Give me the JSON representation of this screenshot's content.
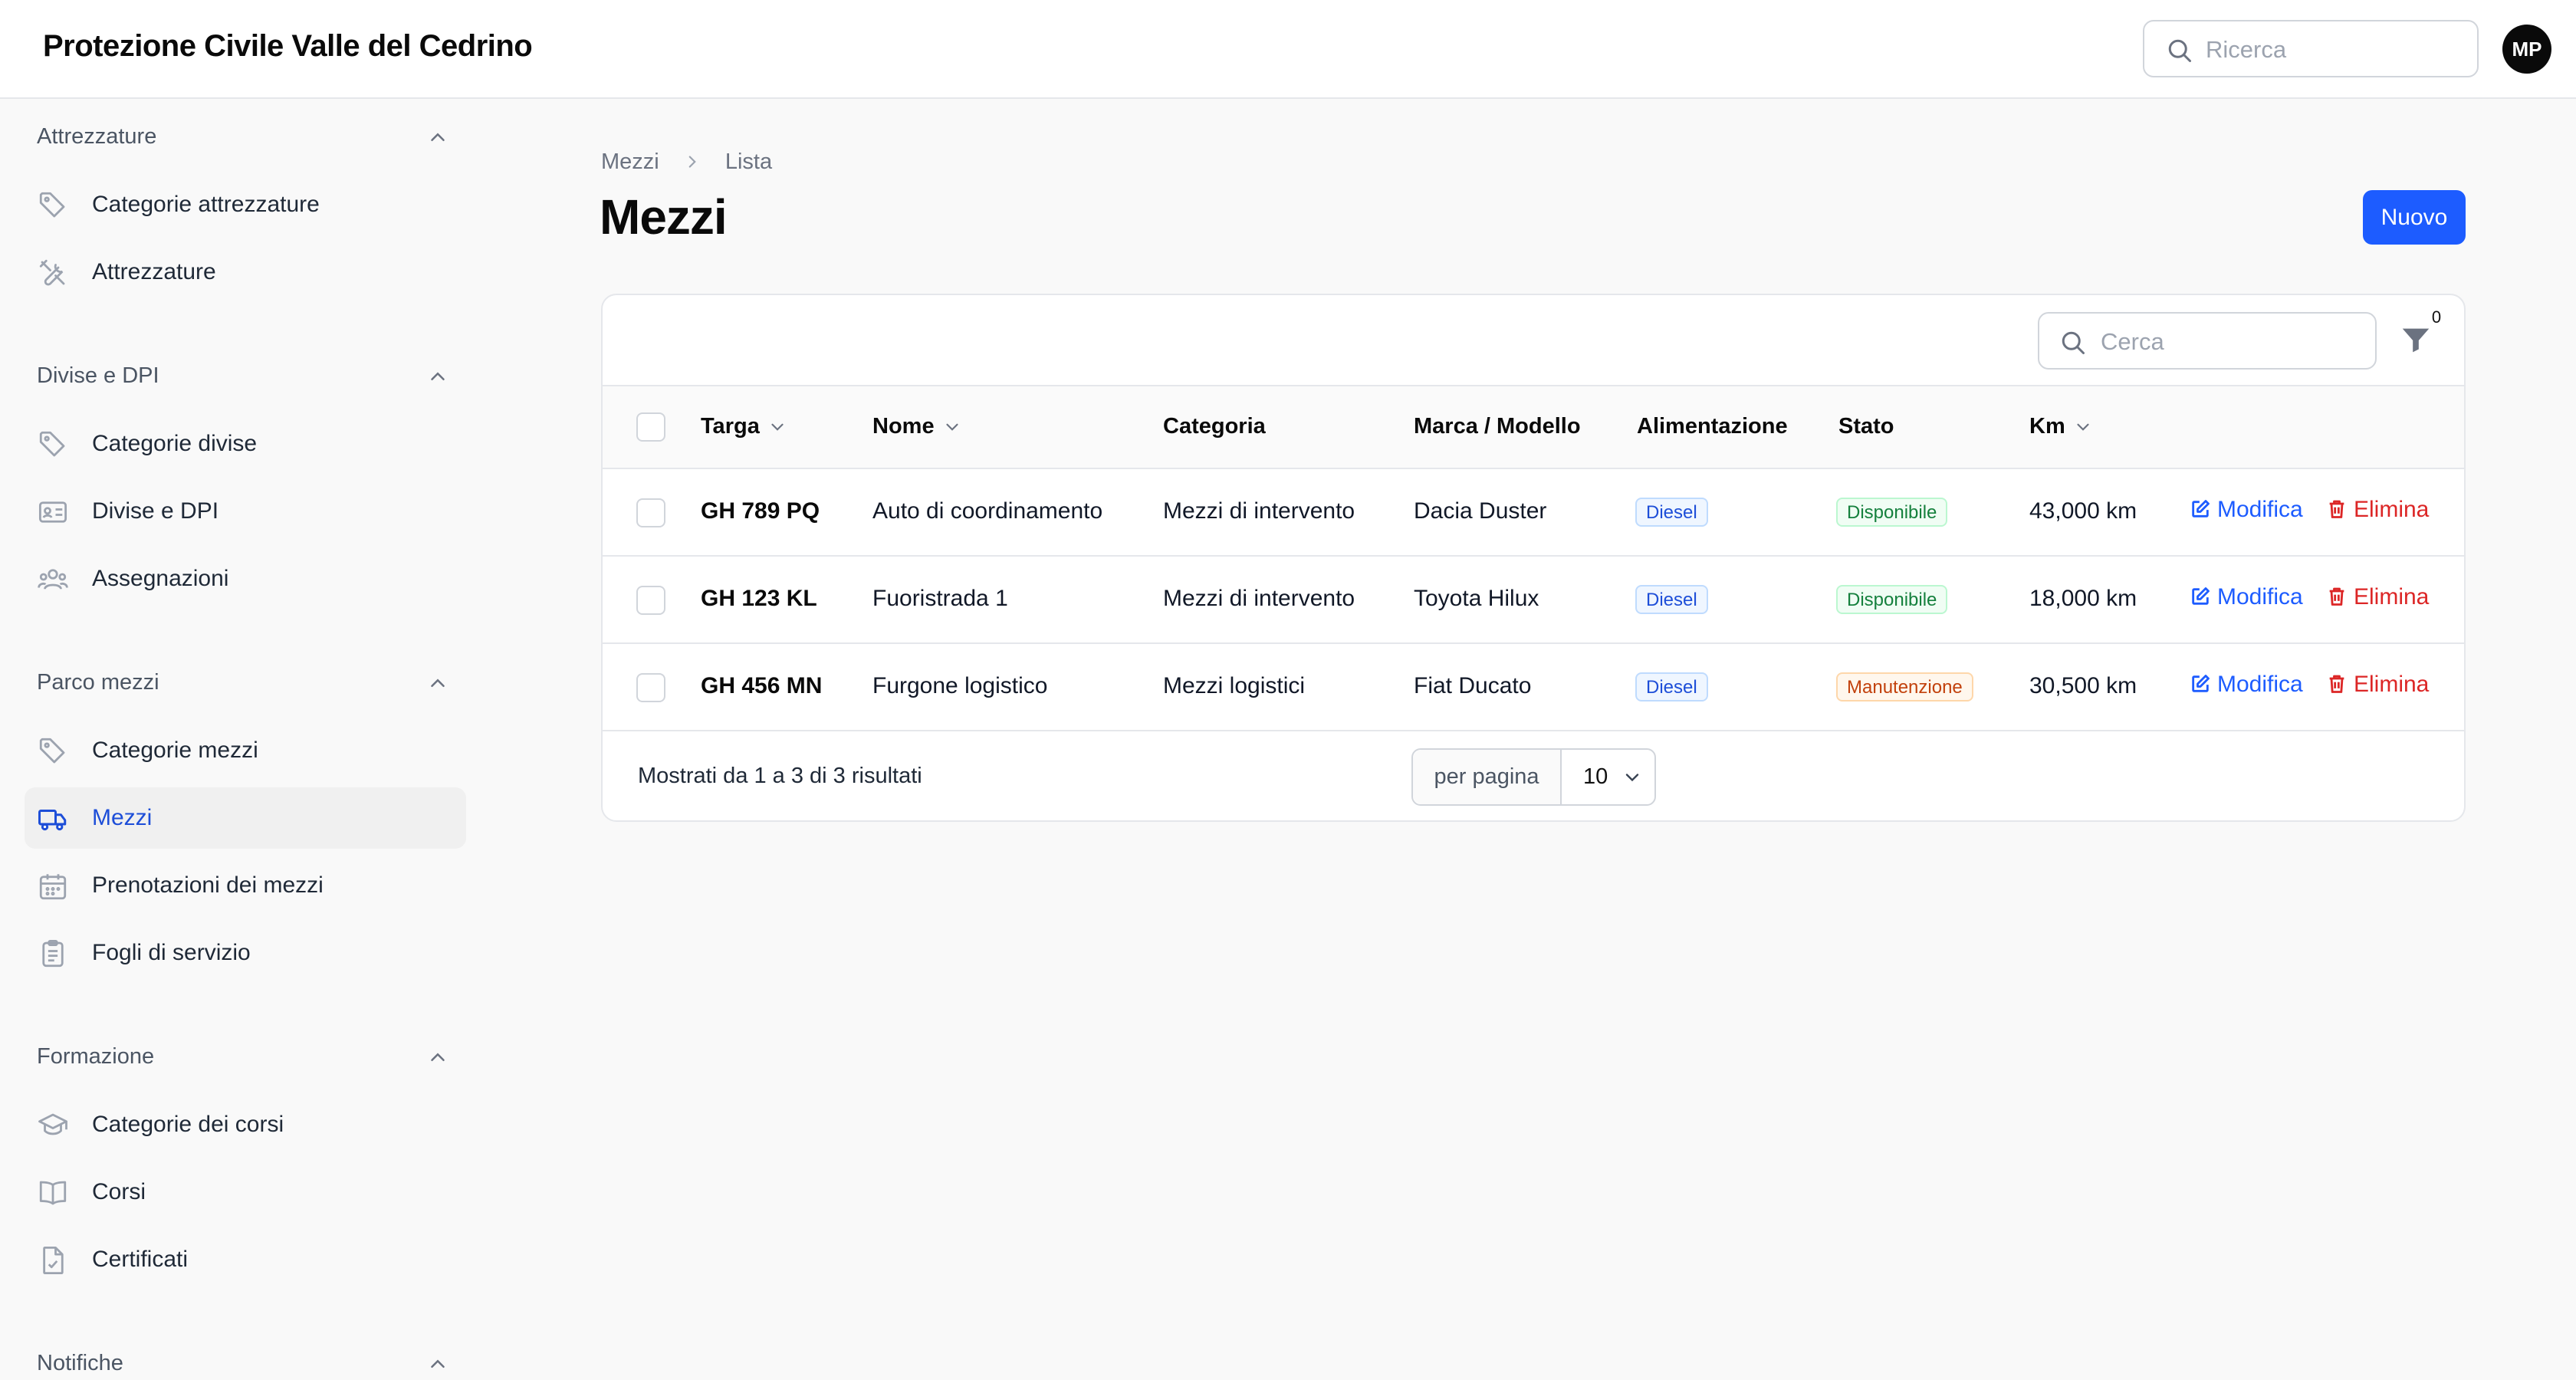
{
  "app": {
    "title": "Protezione Civile Valle del Cedrino",
    "search_placeholder": "Ricerca",
    "user_initials": "MP"
  },
  "sidebar": {
    "groups": [
      {
        "label": "Attrezzature",
        "items": [
          {
            "label": "Categorie attrezzature",
            "icon": "tag-icon"
          },
          {
            "label": "Attrezzature",
            "icon": "tools-icon"
          }
        ]
      },
      {
        "label": "Divise e DPI",
        "items": [
          {
            "label": "Categorie divise",
            "icon": "tag-icon"
          },
          {
            "label": "Divise e DPI",
            "icon": "id-card-icon"
          },
          {
            "label": "Assegnazioni",
            "icon": "users-icon"
          }
        ]
      },
      {
        "label": "Parco mezzi",
        "items": [
          {
            "label": "Categorie mezzi",
            "icon": "tag-icon"
          },
          {
            "label": "Mezzi",
            "icon": "truck-icon",
            "active": true
          },
          {
            "label": "Prenotazioni dei mezzi",
            "icon": "calendar-icon"
          },
          {
            "label": "Fogli di servizio",
            "icon": "clipboard-icon"
          }
        ]
      },
      {
        "label": "Formazione",
        "items": [
          {
            "label": "Categorie dei corsi",
            "icon": "graduation-cap-icon"
          },
          {
            "label": "Corsi",
            "icon": "book-icon"
          },
          {
            "label": "Certificati",
            "icon": "document-check-icon"
          }
        ]
      },
      {
        "label": "Notifiche",
        "items": []
      }
    ]
  },
  "breadcrumb": {
    "parent": "Mezzi",
    "current": "Lista"
  },
  "page": {
    "title": "Mezzi",
    "new_button": "Nuovo"
  },
  "table": {
    "search_placeholder": "Cerca",
    "filter_count": "0",
    "columns": {
      "plate": "Targa",
      "name": "Nome",
      "category": "Categoria",
      "model": "Marca / Modello",
      "fuel": "Alimentazione",
      "status": "Stato",
      "km": "Km"
    },
    "rows": [
      {
        "plate": "GH 789 PQ",
        "name": "Auto di coordinamento",
        "category": "Mezzi di intervento",
        "model": "Dacia Duster",
        "fuel": "Diesel",
        "status": "Disponibile",
        "km": "43,000 km"
      },
      {
        "plate": "GH 123 KL",
        "name": "Fuoristrada 1",
        "category": "Mezzi di intervento",
        "model": "Toyota Hilux",
        "fuel": "Diesel",
        "status": "Disponibile",
        "km": "18,000 km"
      },
      {
        "plate": "GH 456 MN",
        "name": "Furgone logistico",
        "category": "Mezzi logistici",
        "model": "Fiat Ducato",
        "fuel": "Diesel",
        "status": "Manutenzione",
        "km": "30,500 km"
      }
    ],
    "actions": {
      "edit": "Modifica",
      "delete": "Elimina"
    },
    "footer": {
      "results_text": "Mostrati da 1 a 3 di 3 risultati",
      "per_page_label": "per pagina",
      "per_page_value": "10"
    }
  },
  "colors": {
    "accent": "#1d5cff",
    "danger": "#dc2626",
    "active_nav": "#1d4ed8"
  }
}
